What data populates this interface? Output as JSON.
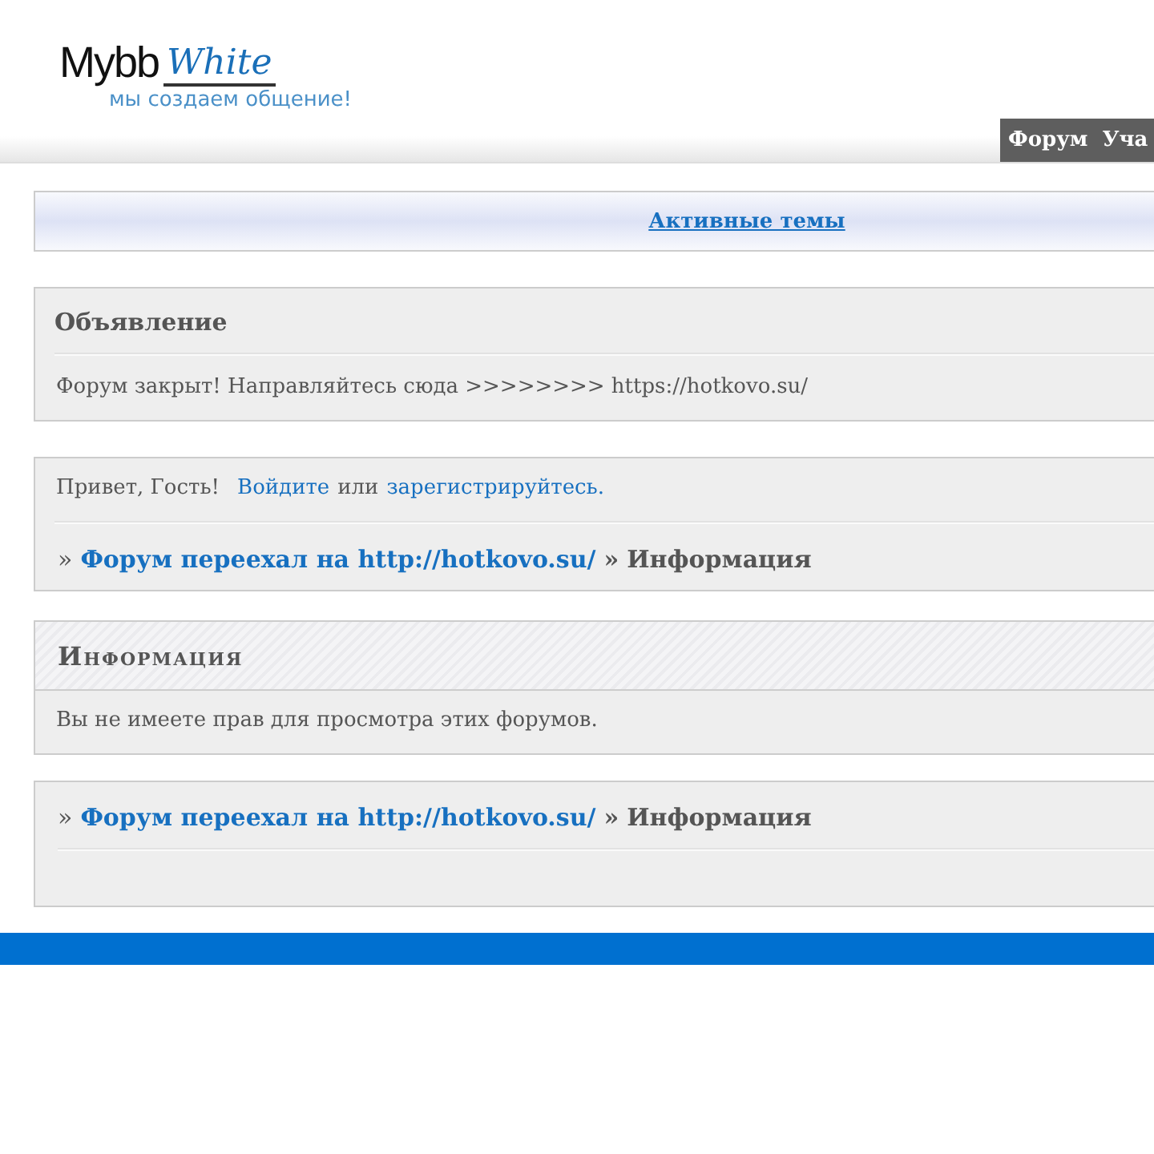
{
  "logo": {
    "brand": "Mybb",
    "accent": "White",
    "tagline": "мы создаем общение!"
  },
  "nav": [
    {
      "label": "Форум"
    },
    {
      "label": "Уча"
    }
  ],
  "active_topics_link": "Активные темы",
  "announcement": {
    "title": "Объявление",
    "text": "Форум закрыт! Направляйтесь сюда >>>>>>>> https://hotkovo.su/"
  },
  "welcome": {
    "greeting": "Привет, Гость!",
    "login_link": "Войдите",
    "or": "или",
    "register_link": "зарегистрируйтесь."
  },
  "breadcrumbs": [
    {
      "separator": "»",
      "link": "Форум переехал на http://hotkovo.su/",
      "separator_2": "»",
      "current": "Информация"
    },
    {
      "separator": "»",
      "link": "Форум переехал на http://hotkovo.su/",
      "separator_2": "»",
      "current": "Информация"
    }
  ],
  "info": {
    "title": "Информация",
    "text": "Вы не имеете прав для просмотра этих форумов."
  }
}
